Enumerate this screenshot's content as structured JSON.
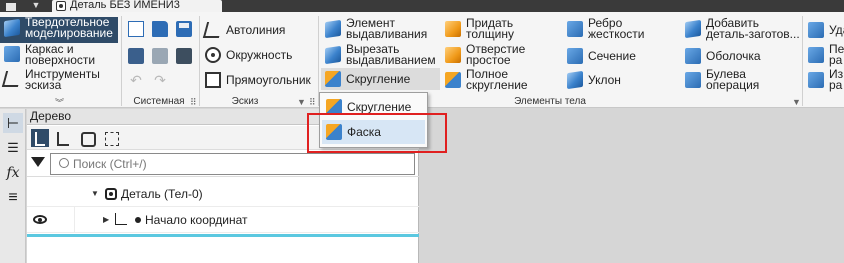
{
  "window": {
    "title": "Деталь БЕЗ ИМЕНИ3"
  },
  "ribbon": {
    "modes": [
      {
        "label": "Твердотельное\nмоделирование",
        "active": true
      },
      {
        "label": "Каркас и\nповерхности",
        "active": false
      },
      {
        "label": "Инструменты\nэскиза",
        "active": false
      }
    ],
    "groups": {
      "system": "Системная",
      "sketch": "Эскиз",
      "body": "Элементы тела"
    },
    "sketch": {
      "autoline": "Автолиния",
      "circle": "Окружность",
      "rectangle": "Прямоугольник"
    },
    "body": {
      "extrude": "Элемент\nвыдавливания",
      "cut_extrude": "Вырезать\nвыдавливанием",
      "fillet": "Скругление",
      "thicken": "Придать\nтолщину",
      "hole": "Отверстие\nпростое",
      "full_fillet": "Полное\nскругление",
      "rib": "Ребро\nжесткости",
      "section": "Сечение",
      "draft": "Уклон",
      "add_blank": "Добавить\nдеталь-заготов...",
      "shell": "Оболочка",
      "boolean": "Булева\nоперация",
      "partial_1": "Уда",
      "partial_2": "Пе\nра",
      "partial_3": "Из\nра"
    }
  },
  "dropdown": {
    "items": [
      {
        "label": "Скругление"
      },
      {
        "label": "Фаска"
      }
    ],
    "highlight_color": "#e02020"
  },
  "left_toolbar": {
    "fx_label": "fx"
  },
  "tree": {
    "header": "Дерево",
    "search_placeholder": "Поиск (Ctrl+/)",
    "nodes": [
      {
        "label": "Деталь (Тел-0)"
      },
      {
        "label": "Начало координат"
      }
    ]
  },
  "colors": {
    "accent": "#2f4b68",
    "highlight_row": "#d7e6f5",
    "tree_line": "#5bc8e0"
  }
}
